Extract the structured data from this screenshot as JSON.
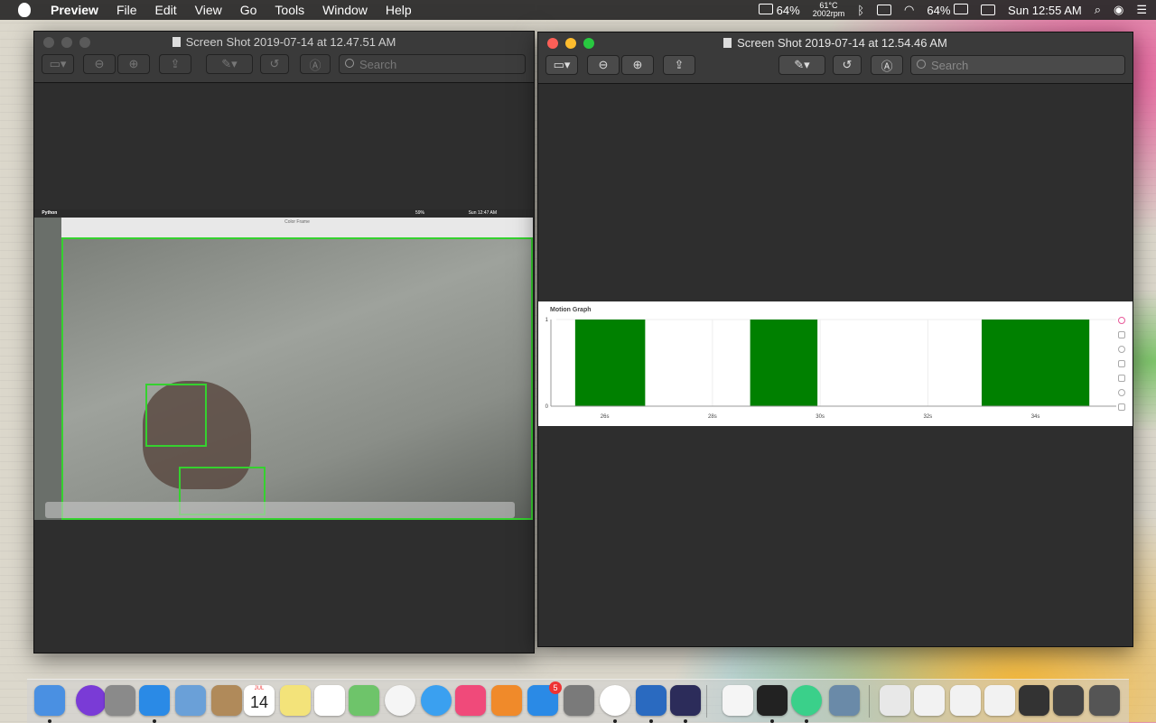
{
  "menubar": {
    "app": "Preview",
    "items": [
      "File",
      "Edit",
      "View",
      "Go",
      "Tools",
      "Window",
      "Help"
    ],
    "battery_pct": "64%",
    "temp": "61°C",
    "rpm": "2002rpm",
    "battery2_pct": "64%",
    "clock": "Sun 12:55 AM"
  },
  "left_window": {
    "title": "Screen Shot 2019-07-14 at 12.47.51 AM",
    "search_placeholder": "Search",
    "embedded": {
      "menubar_app": "Python",
      "menubar_clock": "Sun 12:47 AM",
      "battery": "59%",
      "frame_title": "Color Frame"
    }
  },
  "right_window": {
    "title": "Screen Shot 2019-07-14 at 12.54.46 AM",
    "search_placeholder": "Search"
  },
  "chart_data": {
    "type": "bar",
    "title": "Motion Graph",
    "x_tick_labels": [
      "26s",
      "28s",
      "30s",
      "32s",
      "34s"
    ],
    "y_tick_labels": [
      "0",
      "1"
    ],
    "ylim": [
      0,
      1
    ],
    "xlim": [
      25.1,
      35.5
    ],
    "bars": [
      {
        "start": 25.45,
        "end": 26.75,
        "value": 1
      },
      {
        "start": 28.7,
        "end": 29.95,
        "value": 1
      },
      {
        "start": 33.0,
        "end": 35.0,
        "value": 1
      }
    ],
    "bar_color": "#008000",
    "grid": true
  },
  "dock": {
    "icons": [
      "finder-icon",
      "siri-icon",
      "launchpad-icon",
      "safari-icon",
      "mail-icon",
      "notes-icon",
      "calendar-icon",
      "stickies-icon",
      "reminders-icon",
      "maps-icon",
      "photos-icon",
      "messages-icon",
      "itunes-icon",
      "ibooks-icon",
      "app-store-icon",
      "system-preferences-icon",
      "chrome-icon",
      "vscode-icon",
      "eclipse-icon",
      "textedit-icon",
      "terminal-icon",
      "atom-icon",
      "preview-icon",
      "downloads-icon",
      "doc1-icon",
      "doc2-icon",
      "doc3-icon",
      "doc4-icon",
      "doc5-icon",
      "doc6-icon",
      "trash-icon"
    ],
    "calendar_day": "14",
    "calendar_month": "JUL",
    "app_store_badge": "5"
  }
}
